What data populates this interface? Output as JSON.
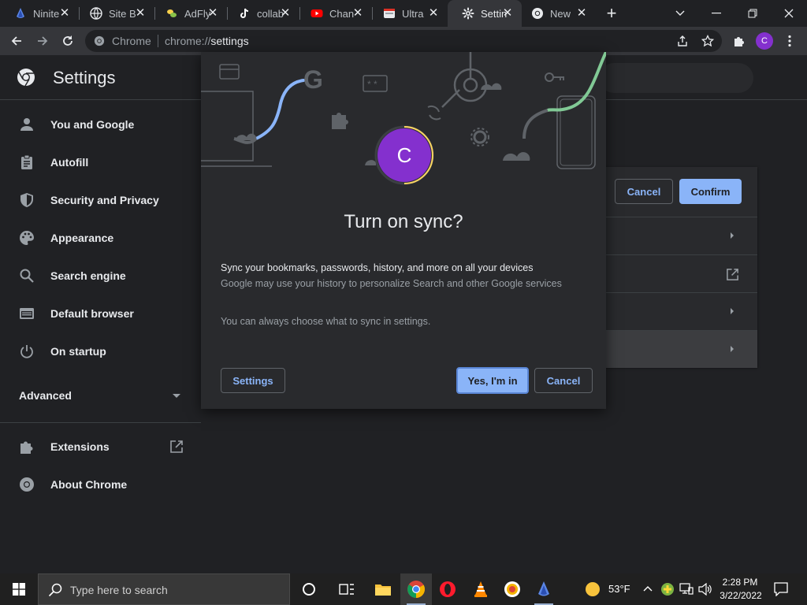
{
  "tabs": [
    {
      "title": "Ninite",
      "icon": "ninite-icon",
      "active": false
    },
    {
      "title": "Site B",
      "icon": "globe-icon",
      "active": false
    },
    {
      "title": "AdFly",
      "icon": "adfly-icon",
      "active": false
    },
    {
      "title": "collab",
      "icon": "tiktok-icon",
      "active": false
    },
    {
      "title": "Chan",
      "icon": "youtube-icon",
      "active": false
    },
    {
      "title": "Ultra",
      "icon": "ultra-icon",
      "active": false
    },
    {
      "title": "Settin",
      "icon": "gear-icon",
      "active": true
    },
    {
      "title": "New",
      "icon": "chrome-icon",
      "active": false
    }
  ],
  "omnibox": {
    "site_label": "Chrome",
    "url_prefix": "chrome://",
    "url_path": "settings"
  },
  "profile_initial": "C",
  "settings": {
    "title": "Settings",
    "nav": [
      {
        "label": "You and Google",
        "icon": "person-icon"
      },
      {
        "label": "Autofill",
        "icon": "clipboard-icon"
      },
      {
        "label": "Security and Privacy",
        "icon": "shield-icon"
      },
      {
        "label": "Appearance",
        "icon": "palette-icon"
      },
      {
        "label": "Search engine",
        "icon": "search-icon"
      },
      {
        "label": "Default browser",
        "icon": "browser-icon"
      },
      {
        "label": "On startup",
        "icon": "power-icon"
      }
    ],
    "advanced_label": "Advanced",
    "extensions_label": "Extensions",
    "about_label": "About Chrome"
  },
  "background_card": {
    "cancel_label": "Cancel",
    "confirm_label": "Confirm"
  },
  "dialog": {
    "avatar_initial": "C",
    "title": "Turn on sync?",
    "desc_primary": "Sync your bookmarks, passwords, history, and more on all your devices",
    "desc_secondary": "Google may use your history to personalize Search and other Google services",
    "desc_note": "You can always choose what to sync in settings.",
    "settings_button": "Settings",
    "confirm_button": "Yes, I'm in",
    "cancel_button": "Cancel",
    "illustration_letter": "G"
  },
  "taskbar": {
    "search_placeholder": "Type here to search",
    "weather_temp": "53°F",
    "clock_time": "2:28 PM",
    "clock_date": "3/22/2022"
  },
  "colors": {
    "accent": "#8ab4f8",
    "avatar": "#8430ce",
    "background": "#202124",
    "surface": "#292a2d"
  }
}
